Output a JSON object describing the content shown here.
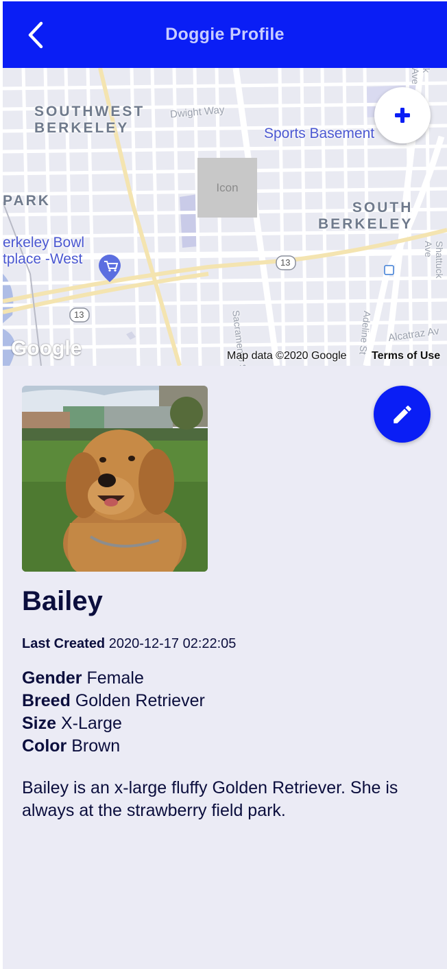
{
  "header": {
    "title": "Doggie Profile"
  },
  "map": {
    "labels": {
      "southwest_berkeley": "SOUTHWEST\nBERKELEY",
      "south_berkeley": "SOUTH\nBERKELEY",
      "park": "PARK",
      "dwight_way": "Dwight Way",
      "sacramento": "Sacramento S",
      "shattuck": "Shattuck Ave",
      "alcatraz": "Alcatraz Av",
      "adeline": "Adeline St",
      "k_ave": "k Ave",
      "route_13_a": "13",
      "route_13_b": "13",
      "sports_basement": "Sports Basement",
      "berkeley_bowl": "erkeley Bowl\ntplace -West"
    },
    "icon_placeholder": "Icon",
    "google_logo": "Google",
    "attribution": "Map data ©2020 Google",
    "terms": "Terms of Use"
  },
  "profile": {
    "name": "Bailey",
    "last_created_label": "Last Created",
    "last_created_value": "2020-12-17 02:22:05",
    "gender_label": "Gender",
    "gender_value": "Female",
    "breed_label": "Breed",
    "breed_value": "Golden Retriever",
    "size_label": "Size",
    "size_value": "X-Large",
    "color_label": "Color",
    "color_value": "Brown",
    "description": "Bailey is an x-large fluffy Golden Retriever. She is always at the strawberry field park."
  },
  "colors": {
    "primary": "#0a1ef5",
    "header_title": "#c8ccff",
    "background": "#ebebf5",
    "text_dark": "#0b0e3d"
  },
  "icons": {
    "back": "chevron-left-icon",
    "add": "plus-icon",
    "edit": "pencil-icon"
  }
}
